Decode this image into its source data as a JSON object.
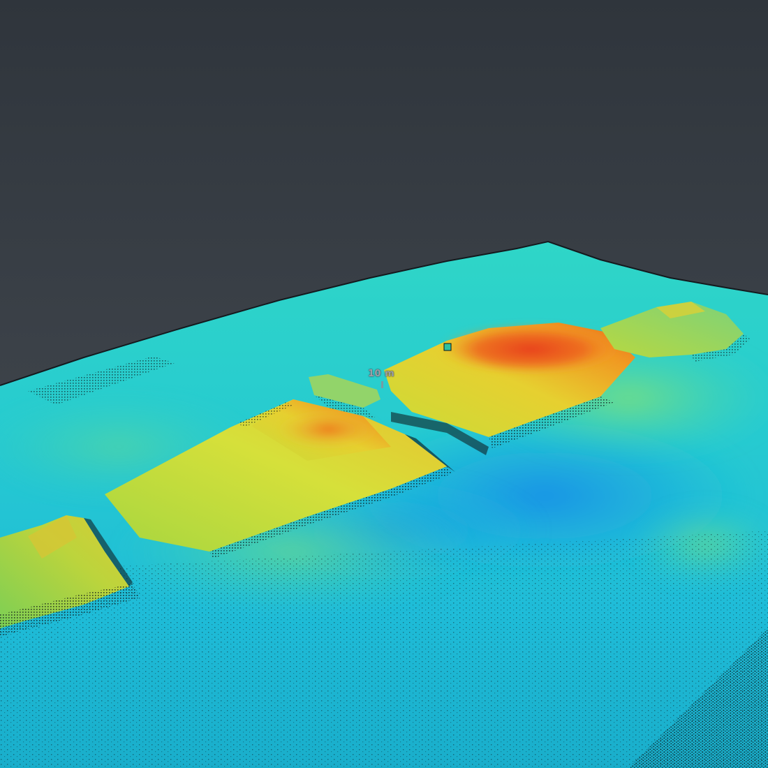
{
  "viewer": {
    "scale_label": "10 m"
  },
  "colors": {
    "background": "#3b4148",
    "seabed_low": "#16b8e0",
    "seabed_mid": "#2ad0c8",
    "seabed_high": "#7de07a",
    "feature_mid": "#d8e23a",
    "feature_high": "#f0a020",
    "feature_peak": "#e8401c",
    "point_speckle": "#0b1a1f"
  },
  "icons": {
    "scale_marker": "scale-tick-icon"
  }
}
